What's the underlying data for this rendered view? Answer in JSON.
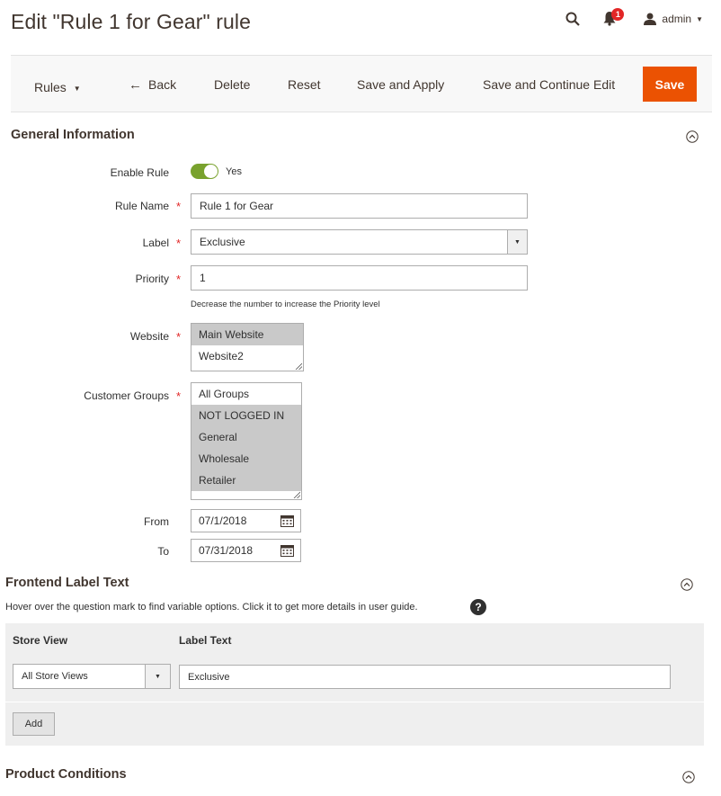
{
  "page": {
    "title": "Edit \"Rule 1 for Gear\" rule"
  },
  "header": {
    "notifications_count": "1",
    "user": "admin"
  },
  "toolbar": {
    "rules_label": "Rules",
    "back_label": "Back",
    "delete_label": "Delete",
    "reset_label": "Reset",
    "save_apply_label": "Save and Apply",
    "save_continue_label": "Save and Continue Edit",
    "save_label": "Save"
  },
  "general": {
    "title": "General Information",
    "enable_label": "Enable Rule",
    "enable_value": "Yes",
    "rule_name_label": "Rule Name",
    "rule_name_value": "Rule 1 for Gear",
    "label_label": "Label",
    "label_value": "Exclusive",
    "priority_label": "Priority",
    "priority_value": "1",
    "priority_note": "Decrease the number to increase the Priority level",
    "website_label": "Website",
    "websites": [
      {
        "name": "Main Website",
        "selected": true
      },
      {
        "name": "Website2",
        "selected": false
      }
    ],
    "customer_groups_label": "Customer Groups",
    "customer_groups": [
      {
        "name": "All Groups",
        "selected": false
      },
      {
        "name": "NOT LOGGED IN",
        "selected": true
      },
      {
        "name": "General",
        "selected": true
      },
      {
        "name": "Wholesale",
        "selected": true
      },
      {
        "name": "Retailer",
        "selected": true
      }
    ],
    "from_label": "From",
    "from_value": "07/1/2018",
    "to_label": "To",
    "to_value": "07/31/2018"
  },
  "frontend": {
    "title": "Frontend Label Text",
    "hint": "Hover over the question mark to find variable options. Click it to get more details in user guide.",
    "col_store_view": "Store View",
    "col_label_text": "Label Text",
    "store_view_value": "All Store Views",
    "label_text_value": "Exclusive",
    "add_label": "Add"
  },
  "conditions": {
    "title": "Product Conditions"
  },
  "colors": {
    "accent": "#eb5202",
    "toggle_on": "#79a22e",
    "required": "#e22626"
  }
}
